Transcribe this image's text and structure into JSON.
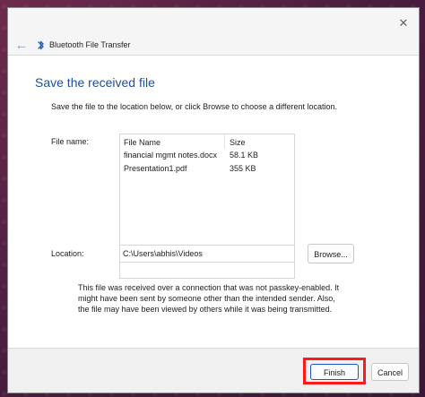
{
  "window": {
    "title": "Bluetooth File Transfer",
    "close_symbol": "✕",
    "back_symbol": "←"
  },
  "content": {
    "heading": "Save the received file",
    "instructions": "Save the file to the location below, or click Browse to choose a different location.",
    "file_name_label": "File name:",
    "location_label": "Location:",
    "location_value": "C:\\Users\\abhis\\Videos",
    "browse_label": "Browse...",
    "warning": "This file was received over a connection that was not passkey-enabled. It might have been sent by someone other than the intended sender. Also, the file may have been viewed by others while it was being transmitted."
  },
  "file_list": {
    "columns": [
      "File Name",
      "Size"
    ],
    "rows": [
      {
        "name": "financial mgmt notes.docx",
        "size": "58.1 KB"
      },
      {
        "name": "Presentation1.pdf",
        "size": "355 KB"
      }
    ]
  },
  "footer": {
    "finish_label": "Finish",
    "cancel_label": "Cancel"
  },
  "icons": {
    "bluetooth": "bluetooth-icon",
    "back": "back-arrow-icon",
    "close": "close-icon"
  },
  "colors": {
    "heading": "#1f4e9a",
    "highlight": "#ff1a1a",
    "finish_border": "#1f57b8"
  }
}
